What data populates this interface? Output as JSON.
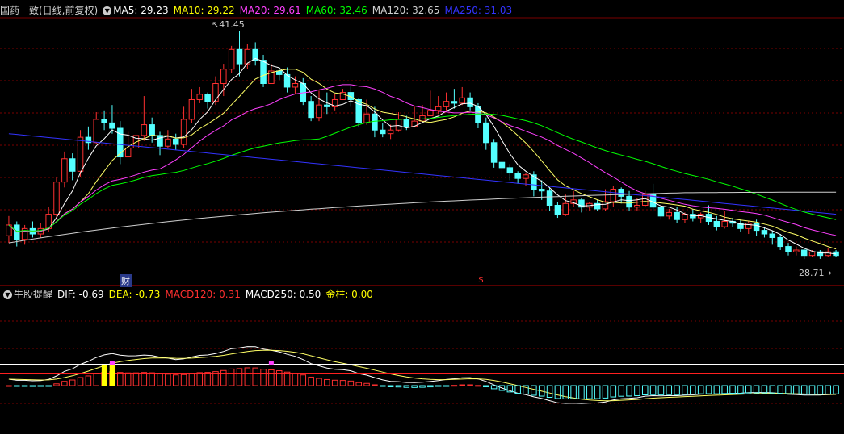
{
  "header": {
    "stock": "国药一致(日线,前复权)",
    "ma": [
      {
        "label": "MA5:",
        "value": "29.23",
        "color": "#ffffff"
      },
      {
        "label": "MA10:",
        "value": "29.22",
        "color": "#ffff00"
      },
      {
        "label": "MA20:",
        "value": "29.61",
        "color": "#ff40ff"
      },
      {
        "label": "MA60:",
        "value": "32.46",
        "color": "#00ff00"
      },
      {
        "label": "MA120:",
        "value": "32.65",
        "color": "#cfcfcf"
      },
      {
        "label": "MA250:",
        "value": "31.03",
        "color": "#3333ff"
      }
    ]
  },
  "annotations": {
    "high": "41.45",
    "low": "28.71",
    "cai": "财",
    "dollar": "$"
  },
  "sub_header": {
    "name": "牛股提醒",
    "items": [
      {
        "label": "DIF:",
        "value": "-0.69",
        "color": "#ffffff"
      },
      {
        "label": "DEA:",
        "value": "-0.73",
        "color": "#ffff00"
      },
      {
        "label": "MACD120:",
        "value": "0.31",
        "color": "#ff3030"
      },
      {
        "label": "MACD250:",
        "value": "0.50",
        "color": "#ffffff"
      },
      {
        "label": "金柱:",
        "value": "0.00",
        "color": "#ffff00"
      }
    ]
  },
  "colors": {
    "up": "#ff3030",
    "down": "#54ffff",
    "ma5": "#ffffff",
    "ma10": "#ffff66",
    "ma20": "#ff40ff",
    "ma60": "#00ff00",
    "ma120": "#cfcfcf",
    "ma250": "#3333ff"
  },
  "chart_data": {
    "type": "candlestick",
    "candles": [
      [
        30.0,
        30.6,
        31.1,
        29.6
      ],
      [
        30.6,
        29.8,
        30.8,
        29.4
      ],
      [
        29.8,
        30.4,
        30.6,
        29.5
      ],
      [
        30.4,
        30.1,
        30.8,
        29.9
      ],
      [
        30.1,
        30.4,
        30.7,
        29.9
      ],
      [
        30.4,
        31.2,
        31.6,
        30.2
      ],
      [
        31.2,
        33.0,
        33.3,
        30.9
      ],
      [
        33.0,
        34.3,
        34.7,
        32.7
      ],
      [
        34.3,
        33.6,
        34.6,
        33.1
      ],
      [
        33.6,
        35.5,
        35.9,
        33.3
      ],
      [
        35.5,
        35.2,
        36.1,
        34.8
      ],
      [
        35.2,
        36.5,
        36.9,
        35.1
      ],
      [
        36.5,
        36.3,
        37.0,
        35.9
      ],
      [
        36.3,
        36.0,
        37.3,
        35.7
      ],
      [
        36.0,
        34.4,
        36.4,
        34.0
      ],
      [
        34.4,
        34.9,
        35.8,
        34.6
      ],
      [
        34.9,
        35.6,
        36.2,
        34.8
      ],
      [
        35.6,
        36.2,
        37.8,
        35.3
      ],
      [
        36.2,
        35.6,
        36.6,
        35.2
      ],
      [
        35.6,
        35.0,
        35.8,
        34.5
      ],
      [
        35.0,
        35.4,
        35.9,
        34.9
      ],
      [
        35.4,
        35.1,
        35.7,
        34.8
      ],
      [
        35.1,
        36.5,
        37.2,
        34.9
      ],
      [
        36.5,
        37.6,
        38.2,
        36.3
      ],
      [
        37.6,
        37.9,
        38.3,
        37.4
      ],
      [
        37.9,
        37.5,
        38.0,
        37.1
      ],
      [
        37.5,
        38.5,
        38.9,
        37.3
      ],
      [
        38.5,
        39.3,
        39.6,
        37.8
      ],
      [
        39.3,
        40.4,
        40.6,
        39.1
      ],
      [
        40.4,
        39.6,
        41.45,
        38.9
      ],
      [
        39.6,
        40.4,
        40.7,
        39.3
      ],
      [
        40.4,
        39.8,
        40.8,
        39.5
      ],
      [
        39.8,
        38.5,
        40.1,
        38.3
      ],
      [
        38.5,
        39.2,
        39.6,
        38.9
      ],
      [
        39.2,
        39.0,
        39.4,
        38.7
      ],
      [
        39.0,
        38.3,
        39.4,
        38.0
      ],
      [
        38.3,
        38.5,
        38.9,
        37.9
      ],
      [
        38.5,
        37.5,
        38.8,
        37.3
      ],
      [
        37.5,
        36.6,
        37.8,
        36.4
      ],
      [
        36.6,
        37.3,
        38.1,
        36.4
      ],
      [
        37.3,
        37.2,
        38.0,
        36.8
      ],
      [
        37.2,
        37.6,
        37.9,
        37.0
      ],
      [
        37.6,
        38.0,
        38.2,
        37.6
      ],
      [
        38.0,
        37.6,
        38.4,
        37.2
      ],
      [
        37.6,
        36.3,
        37.7,
        36.1
      ],
      [
        36.3,
        36.8,
        37.6,
        36.2
      ],
      [
        36.8,
        35.9,
        37.2,
        35.5
      ],
      [
        35.9,
        35.7,
        36.3,
        35.5
      ],
      [
        35.7,
        35.9,
        36.2,
        35.4
      ],
      [
        35.9,
        36.5,
        36.9,
        35.8
      ],
      [
        36.5,
        36.1,
        36.7,
        35.9
      ],
      [
        36.1,
        36.4,
        37.2,
        36.3
      ],
      [
        36.4,
        36.7,
        37.3,
        36.5
      ],
      [
        36.7,
        37.0,
        38.1,
        36.7
      ],
      [
        37.0,
        37.2,
        37.8,
        36.8
      ],
      [
        37.2,
        37.5,
        38.0,
        37.0
      ],
      [
        37.5,
        37.4,
        38.2,
        37.1
      ],
      [
        37.4,
        37.7,
        38.3,
        37.3
      ],
      [
        37.7,
        37.2,
        38.0,
        37.0
      ],
      [
        37.2,
        36.3,
        37.4,
        36.0
      ],
      [
        36.3,
        35.2,
        36.6,
        34.8
      ],
      [
        35.2,
        34.1,
        35.4,
        33.8
      ],
      [
        34.1,
        33.8,
        34.2,
        33.4
      ],
      [
        33.8,
        33.5,
        34.0,
        33.1
      ],
      [
        33.5,
        33.2,
        33.6,
        32.9
      ],
      [
        33.2,
        33.4,
        33.5,
        32.8
      ],
      [
        33.4,
        32.6,
        33.6,
        32.2
      ],
      [
        32.6,
        32.5,
        33.1,
        32.0
      ],
      [
        32.5,
        31.7,
        32.7,
        31.4
      ],
      [
        31.7,
        31.2,
        31.9,
        31.0
      ],
      [
        31.2,
        31.8,
        32.3,
        31.1
      ],
      [
        31.8,
        32.0,
        32.5,
        31.6
      ],
      [
        32.0,
        31.6,
        32.1,
        31.3
      ],
      [
        31.6,
        31.8,
        31.9,
        31.4
      ],
      [
        31.8,
        31.5,
        32.0,
        31.4
      ],
      [
        31.5,
        31.9,
        32.6,
        31.4
      ],
      [
        31.9,
        32.6,
        32.8,
        31.6
      ],
      [
        32.6,
        32.2,
        32.7,
        31.8
      ],
      [
        32.2,
        31.6,
        32.5,
        31.4
      ],
      [
        31.6,
        31.7,
        32.1,
        31.4
      ],
      [
        31.7,
        32.3,
        32.5,
        31.6
      ],
      [
        32.3,
        31.6,
        32.9,
        31.4
      ],
      [
        31.6,
        31.1,
        31.8,
        30.9
      ],
      [
        31.1,
        31.3,
        31.5,
        30.9
      ],
      [
        31.3,
        30.9,
        31.6,
        30.7
      ],
      [
        30.9,
        31.2,
        31.3,
        30.7
      ],
      [
        31.2,
        31.0,
        31.5,
        30.8
      ],
      [
        31.0,
        31.2,
        31.3,
        30.7
      ],
      [
        31.2,
        30.8,
        31.7,
        30.6
      ],
      [
        30.8,
        30.5,
        31.1,
        30.3
      ],
      [
        30.5,
        30.8,
        31.4,
        30.4
      ],
      [
        30.8,
        30.7,
        31.0,
        30.5
      ],
      [
        30.7,
        30.4,
        30.9,
        30.2
      ],
      [
        30.4,
        30.7,
        30.8,
        30.1
      ],
      [
        30.7,
        30.3,
        30.9,
        30.0
      ],
      [
        30.3,
        30.1,
        30.5,
        29.9
      ],
      [
        30.1,
        29.9,
        30.3,
        29.5
      ],
      [
        29.9,
        29.4,
        30.1,
        29.2
      ],
      [
        29.4,
        29.1,
        29.6,
        28.9
      ],
      [
        29.1,
        29.2,
        29.4,
        28.9
      ],
      [
        29.2,
        28.9,
        29.3,
        28.7
      ],
      [
        28.9,
        29.1,
        29.2,
        28.8
      ],
      [
        29.1,
        28.9,
        29.2,
        28.71
      ],
      [
        28.9,
        29.1,
        29.3,
        28.8
      ],
      [
        29.1,
        28.9,
        29.2,
        28.8
      ]
    ]
  }
}
